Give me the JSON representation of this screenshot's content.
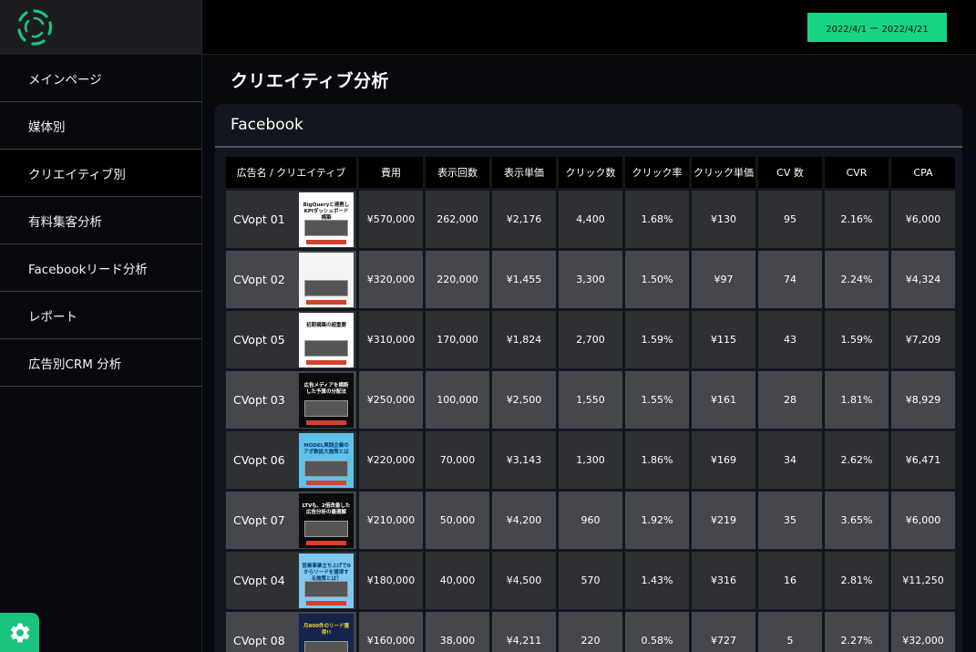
{
  "sidebar": {
    "items": [
      {
        "label": "メインページ"
      },
      {
        "label": "媒体別"
      },
      {
        "label": "クリエイティブ別"
      },
      {
        "label": "有料集客分析"
      },
      {
        "label": "Facebookリード分析"
      },
      {
        "label": "レポート"
      },
      {
        "label": "広告別CRM 分析"
      }
    ],
    "active_index": 2
  },
  "header": {
    "date_range": "2022/4/1 ー 2022/4/21"
  },
  "page": {
    "title": "クリエイティブ分析"
  },
  "card": {
    "title": "Facebook"
  },
  "table": {
    "columns": [
      "広告名 / クリエイティブ",
      "費用",
      "表示回数",
      "表示単価",
      "クリック数",
      "クリック率",
      "クリック単価",
      "CV 数",
      "CVR",
      "CPA"
    ],
    "rows": [
      {
        "name": "CVopt 01",
        "thumb_title": "BigQueryと連携しKPIダッシュボード構築",
        "values": [
          "¥570,000",
          "262,000",
          "¥2,176",
          "4,400",
          "1.68%",
          "¥130",
          "95",
          "2.16%",
          "¥6,000"
        ]
      },
      {
        "name": "CVopt 02",
        "thumb_title": "",
        "values": [
          "¥320,000",
          "220,000",
          "¥1,455",
          "3,300",
          "1.50%",
          "¥97",
          "74",
          "2.24%",
          "¥4,324"
        ]
      },
      {
        "name": "CVopt 05",
        "thumb_title": "初期構築の超重要",
        "values": [
          "¥310,000",
          "170,000",
          "¥1,824",
          "2,700",
          "1.59%",
          "¥115",
          "43",
          "1.59%",
          "¥7,209"
        ]
      },
      {
        "name": "CVopt 03",
        "thumb_title": "広告メディアを横断した予算の分配法",
        "values": [
          "¥250,000",
          "100,000",
          "¥2,500",
          "1,550",
          "1.55%",
          "¥161",
          "28",
          "1.81%",
          "¥8,929"
        ]
      },
      {
        "name": "CVopt 06",
        "thumb_title": "MODEL実践企業のアポ数拡大施策とは",
        "values": [
          "¥220,000",
          "70,000",
          "¥3,143",
          "1,300",
          "1.86%",
          "¥169",
          "34",
          "2.62%",
          "¥6,471"
        ]
      },
      {
        "name": "CVopt 07",
        "thumb_title": "LTVも、2倍改善した広告分析の最適解",
        "values": [
          "¥210,000",
          "50,000",
          "¥4,200",
          "960",
          "1.92%",
          "¥219",
          "35",
          "3.65%",
          "¥6,000"
        ]
      },
      {
        "name": "CVopt 04",
        "thumb_title": "営業事業立ち上げで0からリードを獲得する施策とは？",
        "values": [
          "¥180,000",
          "40,000",
          "¥4,500",
          "570",
          "1.43%",
          "¥316",
          "16",
          "2.81%",
          "¥11,250"
        ]
      },
      {
        "name": "CVopt 08",
        "thumb_title": "月800件のリード獲得!!",
        "values": [
          "¥160,000",
          "38,000",
          "¥4,211",
          "220",
          "0.58%",
          "¥727",
          "5",
          "2.27%",
          "¥32,000"
        ]
      }
    ]
  },
  "thumb_styles": [
    {
      "bg": "#ffffff",
      "fg": "#111111"
    },
    {
      "bg": "#f4f4f4",
      "fg": "#c0392b"
    },
    {
      "bg": "#ffffff",
      "fg": "#111111"
    },
    {
      "bg": "#0c0c0c",
      "fg": "#ffffff"
    },
    {
      "bg": "#5ec2ec",
      "fg": "#0b3a66"
    },
    {
      "bg": "#0c0c0c",
      "fg": "#ffffff"
    },
    {
      "bg": "#7ec8f2",
      "fg": "#0b3a66"
    },
    {
      "bg": "#14244a",
      "fg": "#f4d03f"
    }
  ],
  "colors": {
    "accent": "#18d383",
    "sidebar_bg": "#07090e",
    "card_bg": "#12161e"
  },
  "icons": {
    "logo": "spinner-logo-icon",
    "settings": "gear-icon"
  }
}
